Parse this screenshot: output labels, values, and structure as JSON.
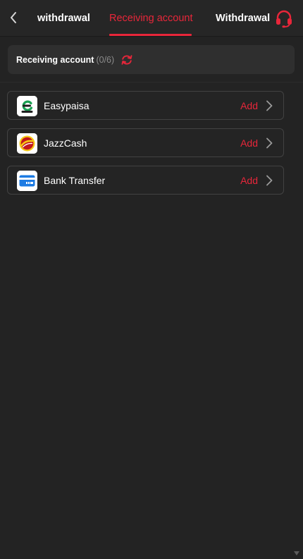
{
  "header": {
    "tabs": [
      {
        "label": "withdrawal"
      },
      {
        "label": "Receiving account"
      },
      {
        "label": "Withdrawal"
      }
    ],
    "active_tab_index": 1,
    "support_icon": "headset-icon",
    "back_icon": "chevron-left-icon"
  },
  "summary": {
    "label": "Receiving account",
    "count": "(0/6)",
    "refresh_icon": "refresh-icon"
  },
  "accounts": [
    {
      "name": "Easypaisa",
      "action": "Add",
      "icon": "easypaisa-logo-icon"
    },
    {
      "name": "JazzCash",
      "action": "Add",
      "icon": "jazzcash-logo-icon"
    },
    {
      "name": "Bank Transfer",
      "action": "Add",
      "icon": "bank-card-icon"
    }
  ],
  "colors": {
    "accent": "#e8263a",
    "background": "#232323",
    "panel": "#2f2f2f",
    "border": "#424242"
  }
}
